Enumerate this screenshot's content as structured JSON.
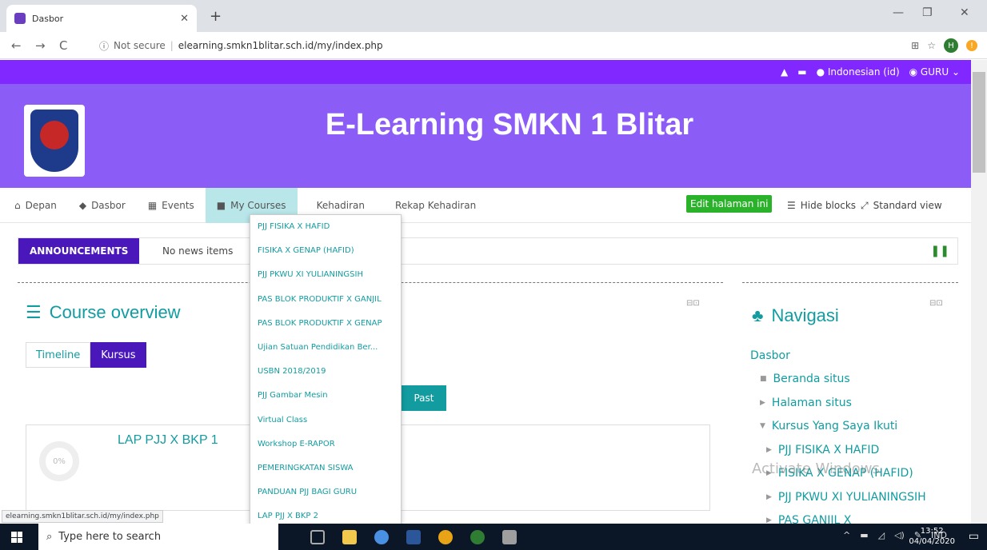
{
  "browser": {
    "tab_title": "Dasbor",
    "not_secure": "Not secure",
    "url": "elearning.smkn1blitar.sch.id/my/index.php",
    "profile_initial": "H"
  },
  "topnav": {
    "language": "Indonesian (id)",
    "user": "GURU"
  },
  "site": {
    "title": "E-Learning SMKN 1 Blitar"
  },
  "mainnav": {
    "items": [
      "Depan",
      "Dasbor",
      "Events",
      "My Courses",
      "Kehadiran",
      "Rekap Kehadiran"
    ],
    "edit_label": "Edit halaman ini",
    "hide_blocks": "Hide blocks",
    "standard_view": "Standard view"
  },
  "announcements": {
    "label": "ANNOUNCEMENTS",
    "text": "No news items"
  },
  "course_overview": {
    "title": "Course overview",
    "tabs": [
      "Timeline",
      "Kursus"
    ],
    "past_label": "Past",
    "course": {
      "name": "LAP PJJ X BKP 1",
      "progress": "0%"
    }
  },
  "mycourses_menu": [
    "PJJ FISIKA X HAFID",
    "FISIKA X GENAP (HAFID)",
    "PJJ PKWU XI YULIANINGSIH",
    "PAS BLOK PRODUKTIF X GANJIL",
    "PAS BLOK PRODUKTIF X GENAP",
    "Ujian Satuan Pendidikan Ber...",
    "USBN 2018/2019",
    "PJJ Gambar Mesin",
    "Virtual Class",
    "Workshop E-RAPOR",
    "PEMERINGKATAN SISWA",
    "PANDUAN PJJ BAGI GURU",
    "LAP PJJ X BKP 2"
  ],
  "navigasi": {
    "title": "Navigasi",
    "dasbor": "Dasbor",
    "items": [
      "Beranda situs",
      "Halaman situs",
      "Kursus Yang Saya Ikuti"
    ],
    "courses": [
      "PJJ FISIKA X HAFID",
      "FISIKA X GENAP (HAFID)",
      "PJJ PKWU XI YULIANINGSIH",
      "PAS GANJIL X"
    ]
  },
  "watermark": "Activate Windows",
  "status_url": "elearning.smkn1blitar.sch.id/my/index.php",
  "taskbar": {
    "search_placeholder": "Type here to search",
    "lang": "IND",
    "time": "13:52",
    "date": "04/04/2020"
  }
}
